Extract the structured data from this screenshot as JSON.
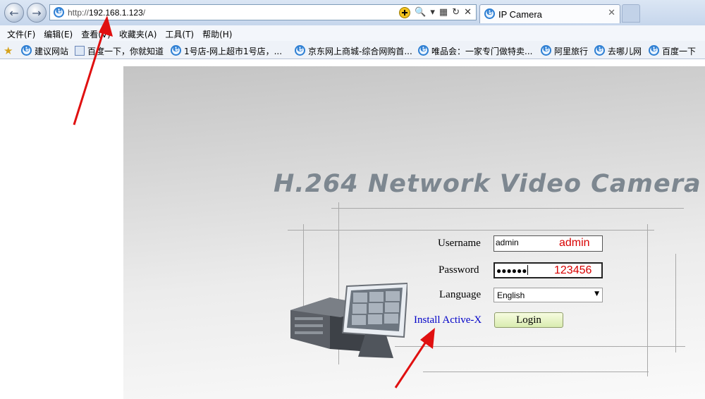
{
  "browser": {
    "address": {
      "prefix": "http://",
      "host": "192.168.1.123",
      "suffix": "/"
    },
    "tab_title": "IP Camera",
    "tab_close": "✕",
    "tool_search": "🔍",
    "tool_dropdown": "▾",
    "tool_compat": "▦",
    "tool_refresh": "↻",
    "tool_stop": "✕",
    "nav_back": "←",
    "nav_forward": "→",
    "menus": [
      "文件(F)",
      "编辑(E)",
      "查看(V)",
      "收藏夹(A)",
      "工具(T)",
      "帮助(H)"
    ],
    "favorites": [
      "建议网站",
      "百度一下，你就知道",
      "1号店-网上超市1号店，...",
      "京东网上商城-综合网购首...",
      "唯品会：一家专门做特卖...",
      "阿里旅行",
      "去哪儿网",
      "百度一下"
    ]
  },
  "page": {
    "heading": "H.264 Network Video Camera",
    "username_label": "Username",
    "username_value": "admin",
    "username_note": "admin",
    "password_label": "Password",
    "password_mask": "●●●●●●",
    "password_note": "123456",
    "language_label": "Language",
    "language_value": "English",
    "install_activex": "Install Active-X",
    "login_button": "Login"
  },
  "colors": {
    "annotation": "#e01010",
    "link": "#0000c8",
    "heading": "#7d8790"
  }
}
